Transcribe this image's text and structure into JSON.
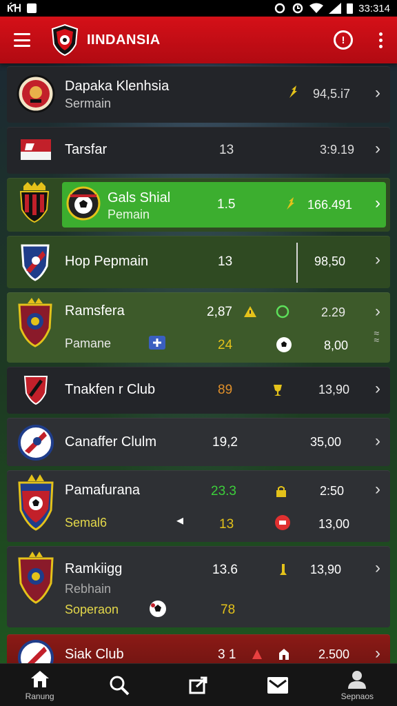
{
  "status_bar": {
    "time": "33:314",
    "left_glyph": "ЌꞪ"
  },
  "app_bar": {
    "title": "IINDANSIA",
    "alert_glyph": "!"
  },
  "rows": [
    {
      "line1": "Dapaka Klenhsia",
      "line2": "Sermain",
      "value": "94,5.i7"
    },
    {
      "line1": "Tarsfar",
      "num1": "13",
      "value": "3:9.19"
    },
    {
      "line1": "Gals Shial",
      "line2": "Pemain",
      "num1": "1.5",
      "value": "166.491"
    },
    {
      "line1": "Hop Pepmain",
      "num1": "13",
      "value": "98,50"
    },
    {
      "line1": "Ramsfera",
      "line2": "Pamane",
      "num1": "2,87",
      "num2": "24",
      "value": "2.29",
      "value2": "8,00"
    },
    {
      "line1": "Tnakfen r Club",
      "num1": "89",
      "value": "13,90"
    },
    {
      "line1": "Canaffer Clulm",
      "num1": "19,2",
      "value": "35,00"
    },
    {
      "line1": "Pamafurana",
      "line2": "Semal6",
      "num1": "23.3",
      "num2": "13",
      "value": "2:50",
      "value2": "13,00"
    },
    {
      "line1": "Ramkiigg",
      "line2": "Rebhain",
      "line3": "Soperaon",
      "num1": "13.6",
      "num2": "78",
      "value": "13,90"
    },
    {
      "line1": "Siak Club",
      "num1": "3 1",
      "value": "2.500"
    }
  ],
  "colors": {
    "accent_red": "#d51018",
    "highlight_green": "#3cae2f",
    "gold": "#e4c21a"
  },
  "nav": [
    {
      "label": "Ranung",
      "icon": "home-icon"
    },
    {
      "label": "",
      "icon": "search-icon"
    },
    {
      "label": "",
      "icon": "share-icon"
    },
    {
      "label": "",
      "icon": "mail-icon"
    },
    {
      "label": "Sepnaos",
      "icon": "profile-icon"
    }
  ]
}
